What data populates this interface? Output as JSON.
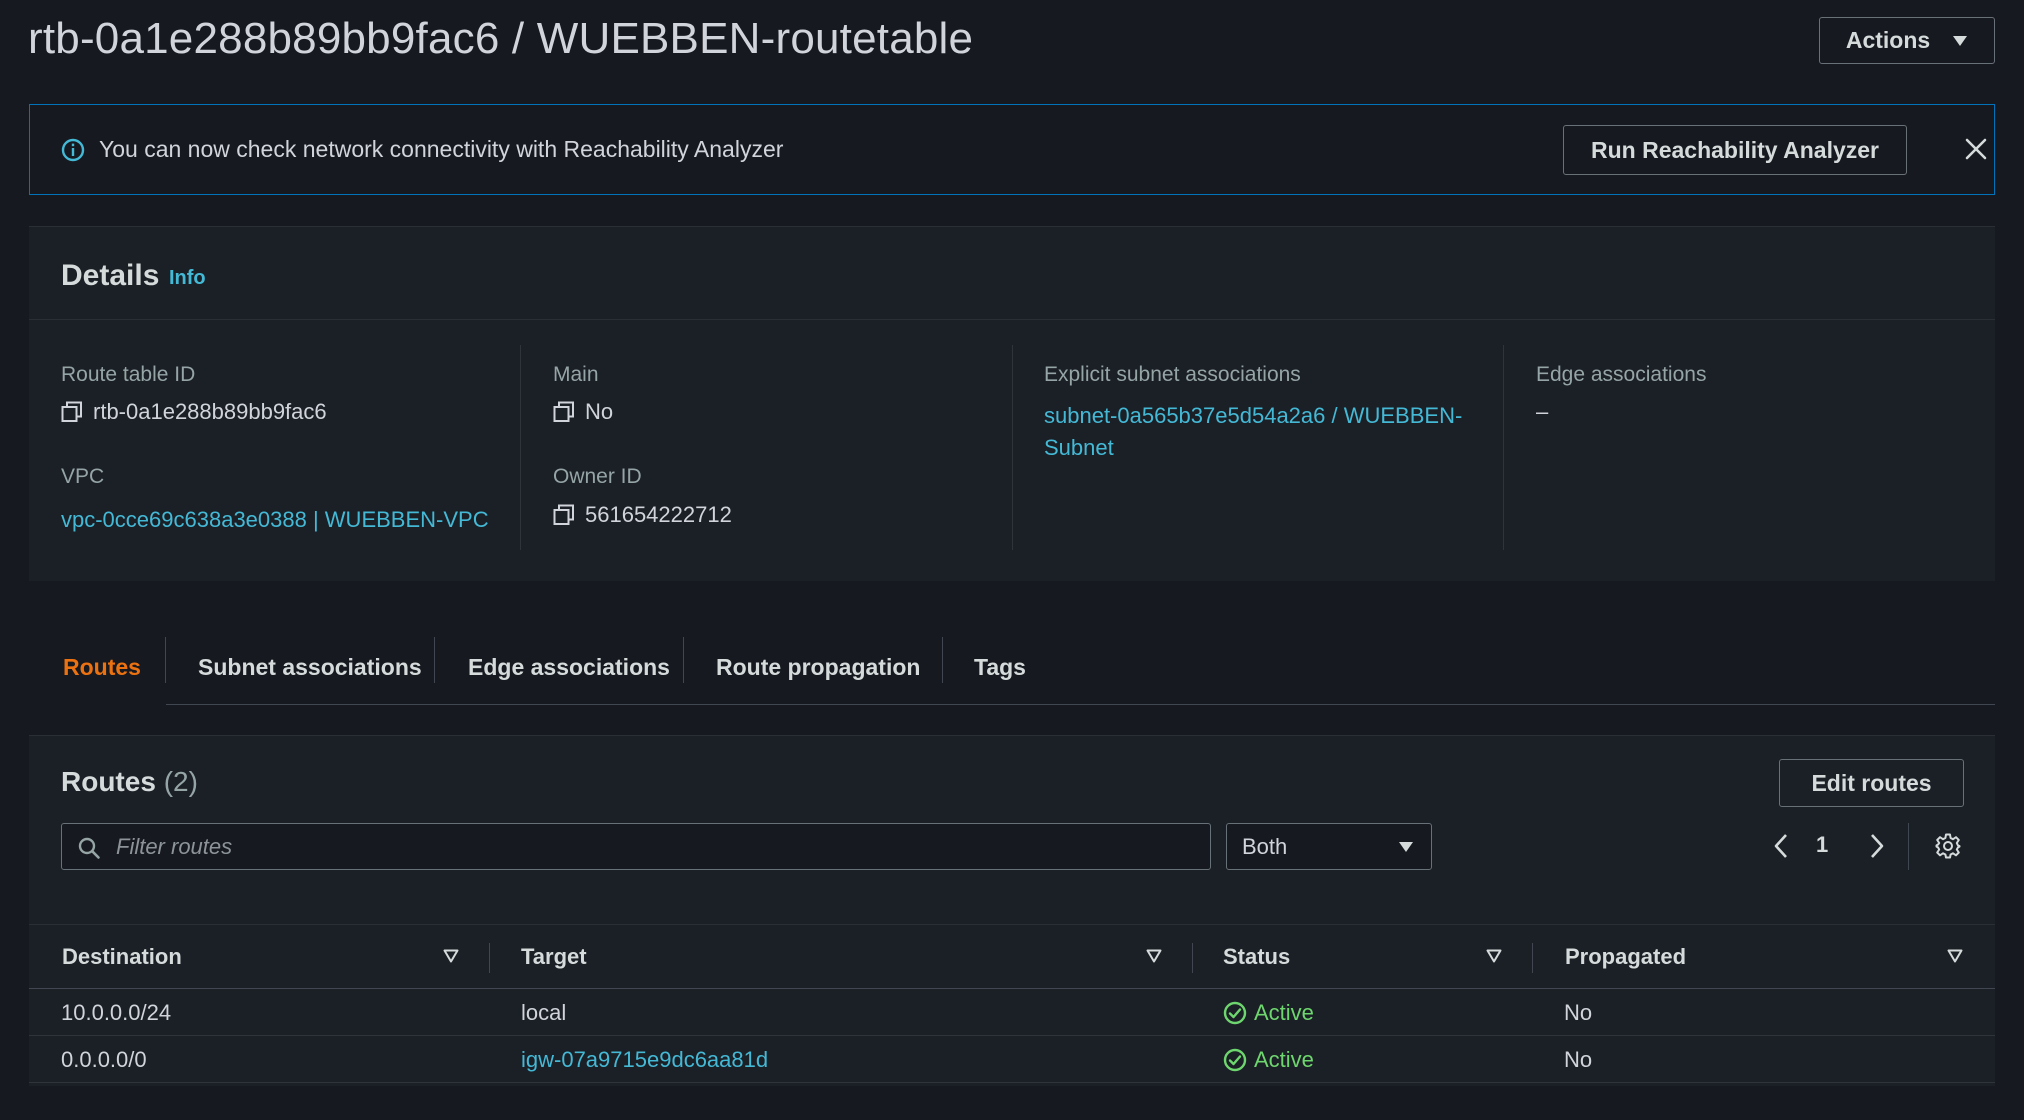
{
  "header": {
    "title": "rtb-0a1e288b89bb9fac6 / WUEBBEN-routetable",
    "actions_label": "Actions"
  },
  "banner": {
    "message": "You can now check network connectivity with Reachability Analyzer",
    "button_label": "Run Reachability Analyzer"
  },
  "details": {
    "heading": "Details",
    "info_link": "Info",
    "fields": {
      "route_table_id": {
        "label": "Route table ID",
        "value": "rtb-0a1e288b89bb9fac6"
      },
      "vpc": {
        "label": "VPC",
        "value": "vpc-0cce69c638a3e0388 | WUEBBEN-VPC"
      },
      "main": {
        "label": "Main",
        "value": "No"
      },
      "owner_id": {
        "label": "Owner ID",
        "value": "561654222712"
      },
      "explicit_subnets": {
        "label": "Explicit subnet associations",
        "value": "subnet-0a565b37e5d54a2a6 / WUEBBEN-Subnet"
      },
      "edge_associations": {
        "label": "Edge associations",
        "value": "–"
      }
    }
  },
  "tabs": [
    {
      "label": "Routes",
      "active": true
    },
    {
      "label": "Subnet associations",
      "active": false
    },
    {
      "label": "Edge associations",
      "active": false
    },
    {
      "label": "Route propagation",
      "active": false
    },
    {
      "label": "Tags",
      "active": false
    }
  ],
  "routes": {
    "heading": "Routes",
    "count": "(2)",
    "edit_label": "Edit routes",
    "filter_placeholder": "Filter routes",
    "filter_select": "Both",
    "page": "1",
    "columns": [
      "Destination",
      "Target",
      "Status",
      "Propagated"
    ],
    "rows": [
      {
        "destination": "10.0.0.0/24",
        "target": "local",
        "target_is_link": false,
        "status": "Active",
        "propagated": "No"
      },
      {
        "destination": "0.0.0.0/0",
        "target": "igw-07a9715e9dc6aa81d",
        "target_is_link": true,
        "status": "Active",
        "propagated": "No"
      }
    ]
  },
  "colors": {
    "background": "#16191f",
    "panel": "#1b1f26",
    "link": "#44b9d6",
    "active_tab": "#ec7211",
    "status_ok": "#6ed66e",
    "banner_border": "#0073bb"
  },
  "icons": [
    "caret-down-icon",
    "info-circle-icon",
    "close-icon",
    "copy-icon",
    "search-icon",
    "chevron-left-icon",
    "chevron-right-icon",
    "gear-icon",
    "sort-icon",
    "check-circle-icon"
  ]
}
